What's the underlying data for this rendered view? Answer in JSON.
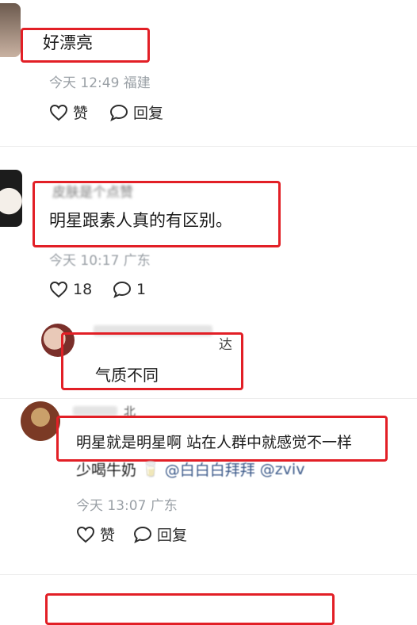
{
  "comments": [
    {
      "text": "好漂亮",
      "meta": "今天 12:49 福建",
      "like_label": "赞",
      "reply_label": "回复"
    },
    {
      "username": "皮肤是个点赞",
      "text": "明星跟素人真的有区别。",
      "meta": "今天 10:17 广东",
      "like_count": "18",
      "reply_count": "1"
    },
    {
      "username": "达",
      "text": "气质不同"
    },
    {
      "username": "北",
      "text": "明星就是明星啊 站在人群中就感觉不一样",
      "continuation": "少喝牛奶",
      "mention1": "@白白白拜拜",
      "mention2": "@zviv",
      "meta": "今天 13:07 广东",
      "like_label": "赞",
      "reply_label": "回复"
    }
  ],
  "colors": {
    "highlight": "#e21f26",
    "meta": "#9aa0a6",
    "mention": "#3c5a8a"
  }
}
